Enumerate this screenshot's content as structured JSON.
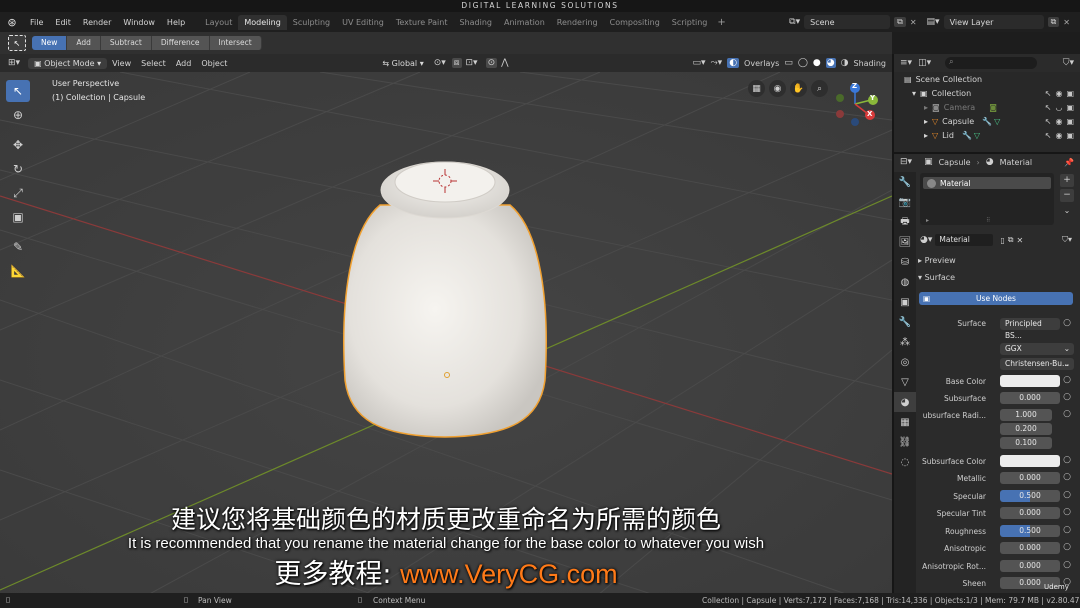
{
  "banner": "DIGITAL LEARNING SOLUTIONS",
  "menu": [
    "File",
    "Edit",
    "Render",
    "Window",
    "Help"
  ],
  "workspaces": [
    "Layout",
    "Modeling",
    "Sculpting",
    "UV Editing",
    "Texture Paint",
    "Shading",
    "Animation",
    "Rendering",
    "Compositing",
    "Scripting"
  ],
  "active_workspace": "Modeling",
  "scene": "Scene",
  "view_layer": "View Layer",
  "tool_modes": [
    "New",
    "Add",
    "Subtract",
    "Difference",
    "Intersect"
  ],
  "viewport_header": {
    "mode": "Object Mode",
    "menus": [
      "View",
      "Select",
      "Add",
      "Object"
    ],
    "transform": "Global",
    "overlays": "Overlays",
    "shading": "Shading"
  },
  "viewport_info": {
    "line1": "User Perspective",
    "line2": "(1) Collection | Capsule"
  },
  "gizmo": {
    "x": "X",
    "y": "Y",
    "z": "Z"
  },
  "outliner": {
    "scene_collection": "Scene Collection",
    "collection": "Collection",
    "items": [
      "Camera",
      "Capsule",
      "Lid"
    ]
  },
  "properties": {
    "breadcrumb_object": "Capsule",
    "breadcrumb_material": "Material",
    "slot_name": "Material",
    "material_name": "Material",
    "preview_label": "Preview",
    "surface_label": "Surface",
    "use_nodes": "Use Nodes",
    "surface_field_label": "Surface",
    "surface_value": "Principled BS...",
    "distribution": "GGX",
    "subsurface_method": "Christensen-Bu...",
    "rows": [
      {
        "label": "Base Color",
        "value": ""
      },
      {
        "label": "Subsurface",
        "value": "0.000"
      },
      {
        "label": "ubsurface Radi...",
        "value": "1.000"
      },
      {
        "label": "",
        "value": "0.200"
      },
      {
        "label": "",
        "value": "0.100"
      },
      {
        "label": "Subsurface Color",
        "value": ""
      },
      {
        "label": "Metallic",
        "value": "0.000"
      },
      {
        "label": "Specular",
        "value": "0.500"
      },
      {
        "label": "Specular Tint",
        "value": "0.000"
      },
      {
        "label": "Roughness",
        "value": "0.500"
      },
      {
        "label": "Anisotropic",
        "value": "0.000"
      },
      {
        "label": "Anisotropic Rot...",
        "value": "0.000"
      },
      {
        "label": "Sheen",
        "value": "0.000"
      }
    ]
  },
  "status": {
    "pan": "Pan View",
    "context": "Context Menu",
    "stats": "Collection | Capsule | Verts:7,172 | Faces:7,168 | Tris:14,336 | Objects:1/3 | Mem: 79.7 MB | v2.80.47",
    "watermark": "Udemy"
  },
  "subtitles": {
    "cn": "建议您将基础颜色的材质更改重命名为所需的颜色",
    "en": "It is recommended that you rename the material change for the base color to whatever you wish",
    "promo_cn": "更多教程: ",
    "promo_url": "www.VeryCG.com"
  }
}
